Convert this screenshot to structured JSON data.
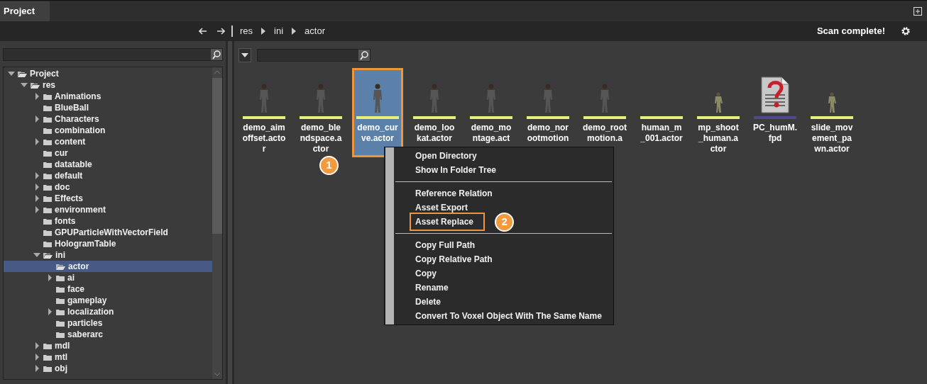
{
  "panel_tab": {
    "label": "Project",
    "selected": true
  },
  "toolbar": {
    "breadcrumb": [
      "res",
      "ini",
      "actor"
    ],
    "status": "Scan complete!"
  },
  "tree": {
    "items": [
      {
        "label": "Project",
        "expandable": true,
        "expanded": true,
        "selected": false,
        "children": [
          {
            "label": "res",
            "expandable": true,
            "expanded": true,
            "selected": false,
            "children": [
              {
                "label": "Animations",
                "expandable": true,
                "expanded": false,
                "selected": false
              },
              {
                "label": "BlueBall",
                "expandable": false,
                "expanded": false,
                "selected": false
              },
              {
                "label": "Characters",
                "expandable": true,
                "expanded": false,
                "selected": false
              },
              {
                "label": "combination",
                "expandable": false,
                "expanded": false,
                "selected": false
              },
              {
                "label": "content",
                "expandable": true,
                "expanded": false,
                "selected": false
              },
              {
                "label": "cur",
                "expandable": false,
                "expanded": false,
                "selected": false
              },
              {
                "label": "datatable",
                "expandable": false,
                "expanded": false,
                "selected": false
              },
              {
                "label": "default",
                "expandable": true,
                "expanded": false,
                "selected": false
              },
              {
                "label": "doc",
                "expandable": true,
                "expanded": false,
                "selected": false
              },
              {
                "label": "Effects",
                "expandable": true,
                "expanded": false,
                "selected": false
              },
              {
                "label": "environment",
                "expandable": true,
                "expanded": false,
                "selected": false
              },
              {
                "label": "fonts",
                "expandable": false,
                "expanded": false,
                "selected": false
              },
              {
                "label": "GPUParticleWithVectorField",
                "expandable": false,
                "expanded": false,
                "selected": false
              },
              {
                "label": "HologramTable",
                "expandable": false,
                "expanded": false,
                "selected": false
              },
              {
                "label": "ini",
                "expandable": true,
                "expanded": true,
                "selected": false,
                "children": [
                  {
                    "label": "actor",
                    "expandable": false,
                    "expanded": false,
                    "selected": true
                  },
                  {
                    "label": "ai",
                    "expandable": true,
                    "expanded": false,
                    "selected": false
                  },
                  {
                    "label": "face",
                    "expandable": false,
                    "expanded": false,
                    "selected": false
                  },
                  {
                    "label": "gameplay",
                    "expandable": false,
                    "expanded": false,
                    "selected": false
                  },
                  {
                    "label": "localization",
                    "expandable": true,
                    "expanded": false,
                    "selected": false
                  },
                  {
                    "label": "particles",
                    "expandable": false,
                    "expanded": false,
                    "selected": false
                  },
                  {
                    "label": "saberarc",
                    "expandable": false,
                    "expanded": false,
                    "selected": false
                  }
                ]
              },
              {
                "label": "mdl",
                "expandable": true,
                "expanded": false,
                "selected": false
              },
              {
                "label": "mtl",
                "expandable": true,
                "expanded": false,
                "selected": false
              },
              {
                "label": "obj",
                "expandable": true,
                "expanded": false,
                "selected": false
              }
            ]
          }
        ]
      }
    ]
  },
  "assets": [
    {
      "name": "demo_aimoffset.actor",
      "kind": "character",
      "color": "#e8f07a",
      "selected": false,
      "highlighted": false
    },
    {
      "name": "demo_blendspace.actor",
      "kind": "character",
      "color": "#e8f07a",
      "selected": false,
      "highlighted": false,
      "callout": "1"
    },
    {
      "name": "demo_curve.actor",
      "kind": "character",
      "color": "#e8f07a",
      "selected": true,
      "highlighted": true
    },
    {
      "name": "demo_lookat.actor",
      "kind": "character",
      "color": "#e8f07a",
      "selected": false,
      "highlighted": false
    },
    {
      "name": "demo_montage.act",
      "kind": "character",
      "color": "#e8f07a",
      "selected": false,
      "highlighted": false
    },
    {
      "name": "demo_norootmotion",
      "kind": "character",
      "color": "#e8f07a",
      "selected": false,
      "highlighted": false
    },
    {
      "name": "demo_rootmotion.a",
      "kind": "character",
      "color": "#e8f07a",
      "selected": false,
      "highlighted": false
    },
    {
      "name": "human_m_001.actor",
      "kind": "none",
      "color": "#e8f07a",
      "selected": false,
      "highlighted": false
    },
    {
      "name": "mp_shoot_human.actor",
      "kind": "soldier",
      "color": "#e8f07a",
      "selected": false,
      "highlighted": false
    },
    {
      "name": "PC_humM.fpd",
      "kind": "document",
      "color": "#4c4a8a",
      "selected": false,
      "highlighted": false
    },
    {
      "name": "slide_movement_pawn.actor",
      "kind": "soldier",
      "color": "#e8f07a",
      "selected": false,
      "highlighted": false
    }
  ],
  "context_menu": {
    "groups": [
      {
        "items": [
          {
            "label": "Open Directory",
            "highlighted": false
          },
          {
            "label": "Show In Folder Tree",
            "highlighted": false
          }
        ]
      },
      {
        "items": [
          {
            "label": "Reference Relation",
            "highlighted": false
          },
          {
            "label": "Asset Export",
            "highlighted": false
          },
          {
            "label": "Asset Replace",
            "highlighted": true,
            "callout": "2"
          }
        ]
      },
      {
        "items": [
          {
            "label": "Copy Full Path",
            "highlighted": false
          },
          {
            "label": "Copy Relative Path",
            "highlighted": false
          },
          {
            "label": "Copy",
            "highlighted": false
          },
          {
            "label": "Rename",
            "highlighted": false
          },
          {
            "label": "Delete",
            "highlighted": false
          },
          {
            "label": "Convert To Voxel Object With The Same Name",
            "highlighted": false
          }
        ]
      }
    ]
  }
}
